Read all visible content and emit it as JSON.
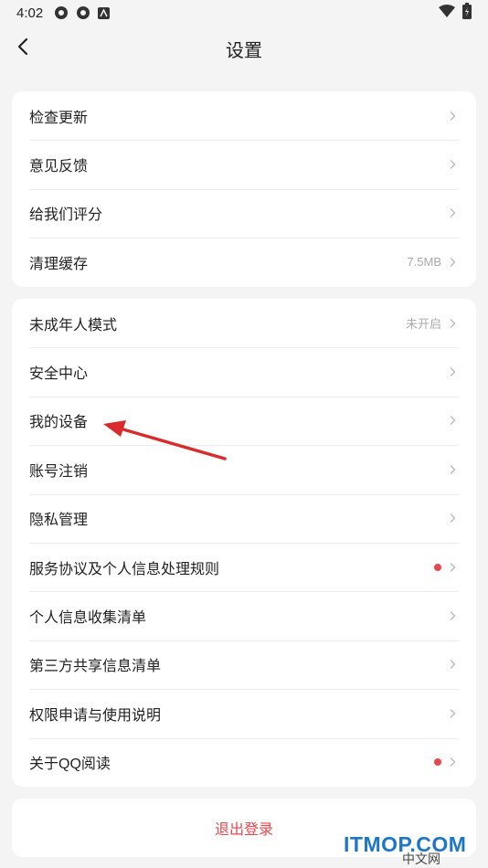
{
  "status_bar": {
    "time": "4:02"
  },
  "header": {
    "title": "设置"
  },
  "group1": [
    {
      "label": "检查更新",
      "value": ""
    },
    {
      "label": "意见反馈",
      "value": ""
    },
    {
      "label": "给我们评分",
      "value": ""
    },
    {
      "label": "清理缓存",
      "value": "7.5MB"
    }
  ],
  "group2": [
    {
      "label": "未成年人模式",
      "value": "未开启"
    },
    {
      "label": "安全中心",
      "value": ""
    },
    {
      "label": "我的设备",
      "value": ""
    },
    {
      "label": "账号注销",
      "value": ""
    },
    {
      "label": "隐私管理",
      "value": ""
    },
    {
      "label": "服务协议及个人信息处理规则",
      "value": "",
      "badge_dot": true
    },
    {
      "label": "个人信息收集清单",
      "value": ""
    },
    {
      "label": "第三方共享信息清单",
      "value": ""
    },
    {
      "label": "权限申请与使用说明",
      "value": ""
    },
    {
      "label": "关于QQ阅读",
      "value": "",
      "badge_dot": true
    }
  ],
  "logout": {
    "label": "退出登录"
  },
  "colors": {
    "accent_red": "#e8474c",
    "background": "#f4f4f4",
    "annotation_arrow": "#d92b2b"
  },
  "watermark": {
    "main": "ITMOP.COM",
    "sub": "中文网"
  }
}
